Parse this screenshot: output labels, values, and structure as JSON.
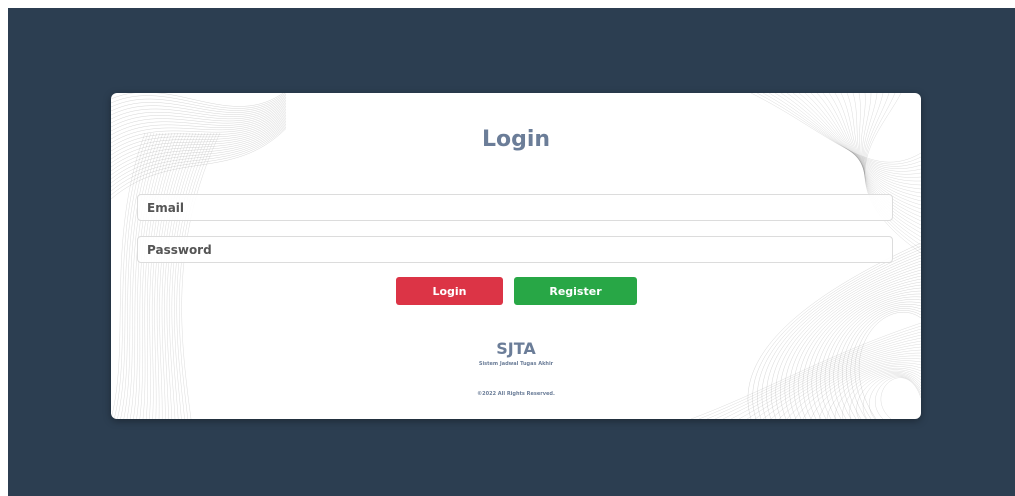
{
  "login_form": {
    "title": "Login",
    "email_placeholder": "Email",
    "password_placeholder": "Password",
    "login_button_label": "Login",
    "register_button_label": "Register"
  },
  "footer": {
    "brand": "SJTA",
    "subtitle": "Sistem Jadwal Tugas Akhir",
    "copyright": "©2022 All Rights Reserved."
  },
  "colors": {
    "page_background": "#2c3e51",
    "card_background": "#ffffff",
    "title_text": "#6b7d98",
    "login_button": "#dc3446",
    "register_button": "#28a746"
  }
}
